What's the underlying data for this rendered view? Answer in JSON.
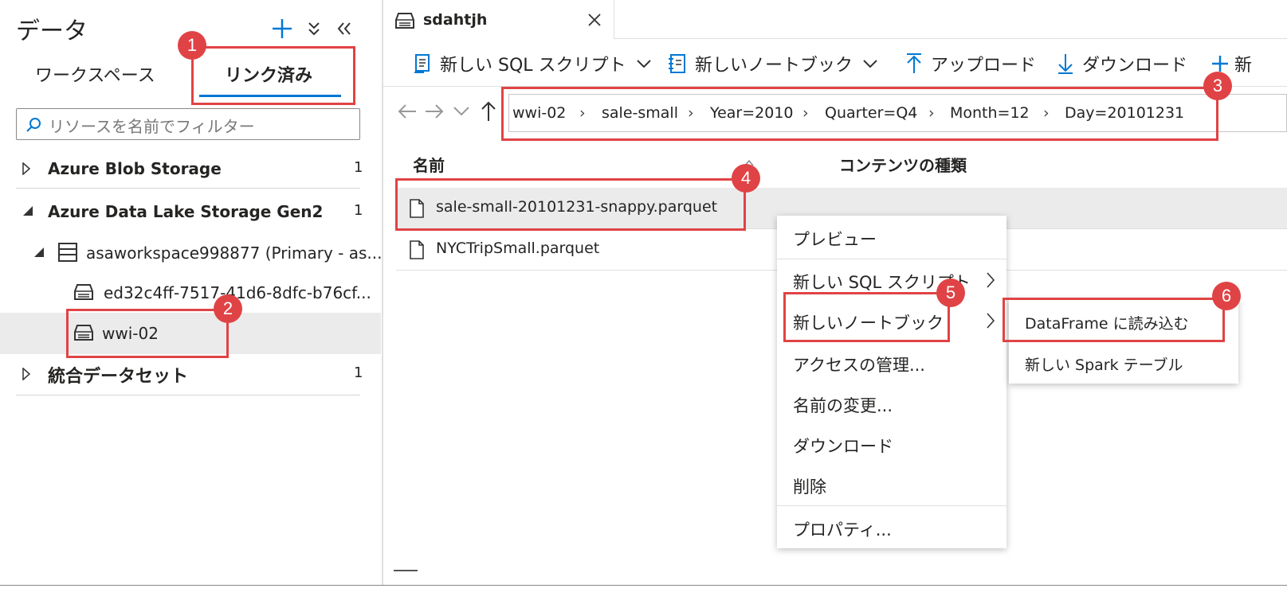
{
  "left_panel": {
    "title": "データ",
    "tabs": [
      {
        "label": "ワークスペース",
        "active": false
      },
      {
        "label": "リンク済み",
        "active": true
      }
    ],
    "filter_placeholder": "リソースを名前でフィルター",
    "tree": [
      {
        "label": "Azure Blob Storage",
        "count": "1",
        "expanded": false
      },
      {
        "label": "Azure Data Lake Storage Gen2",
        "count": "1",
        "expanded": true
      },
      {
        "label": "asaworkspace998877 (Primary - as...",
        "expanded": true
      },
      {
        "label": "ed32c4ff-7517-41d6-8dfc-b76cf..."
      },
      {
        "label": "wwi-02",
        "selected": true
      },
      {
        "label": "統合データセット",
        "count": "1",
        "expanded": false
      }
    ]
  },
  "doc_tab": {
    "title": "sdahtjh"
  },
  "toolbar": {
    "items": [
      {
        "label": "新しい SQL スクリプト",
        "icon": "sql-script-icon",
        "dropdown": true
      },
      {
        "label": "新しいノートブック",
        "icon": "notebook-icon",
        "dropdown": true
      },
      {
        "label": "アップロード",
        "icon": "upload-arrow-icon"
      },
      {
        "label": "ダウンロード",
        "icon": "download-arrow-icon"
      },
      {
        "label": "新",
        "icon": "plus-icon"
      }
    ]
  },
  "breadcrumb": [
    "wwi-02",
    "sale-small",
    "Year=2010",
    "Quarter=Q4",
    "Month=12",
    "Day=20101231"
  ],
  "file_list": {
    "columns": [
      "名前",
      "コンテンツの種類"
    ],
    "rows": [
      {
        "name": "sale-small-20101231-snappy.parquet",
        "selected": true
      },
      {
        "name": "NYCTripSmall.parquet",
        "selected": false
      }
    ]
  },
  "context_menu": {
    "items": [
      {
        "label": "プレビュー"
      },
      {
        "label": "新しい SQL スクリプト",
        "submenu": true
      },
      {
        "label": "新しいノートブック",
        "submenu": true
      },
      {
        "label": "アクセスの管理..."
      },
      {
        "label": "名前の変更..."
      },
      {
        "label": "ダウンロード"
      },
      {
        "label": "削除"
      },
      {
        "label": "プロパティ..."
      }
    ]
  },
  "submenu": {
    "items": [
      {
        "label": "DataFrame に読み込む"
      },
      {
        "label": "新しい Spark テーブル"
      }
    ]
  },
  "annotations": [
    "1",
    "2",
    "3",
    "4",
    "5",
    "6"
  ],
  "colors": {
    "accent": "#0078d4",
    "highlight": "#e04345",
    "selected_row": "#ebebeb"
  }
}
